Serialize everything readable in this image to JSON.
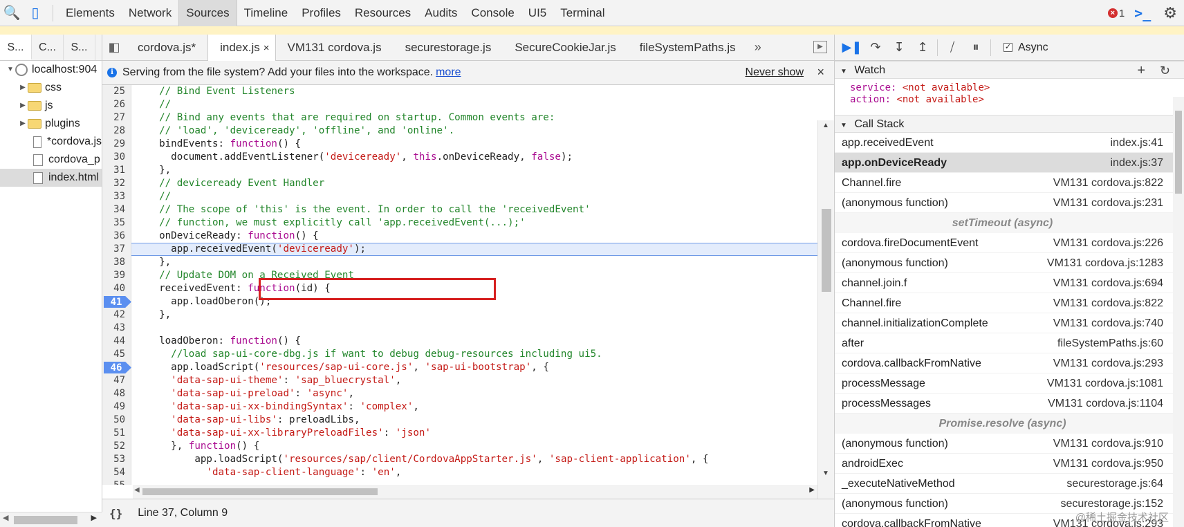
{
  "toolbar": {
    "tabs": [
      "Elements",
      "Network",
      "Sources",
      "Timeline",
      "Profiles",
      "Resources",
      "Audits",
      "Console",
      "UI5",
      "Terminal"
    ],
    "error_count": "1"
  },
  "navigator": {
    "tabs": [
      "S...",
      "C...",
      "S..."
    ],
    "tree": [
      {
        "label": "localhost:904",
        "type": "origin"
      },
      {
        "label": "css",
        "type": "folder"
      },
      {
        "label": "js",
        "type": "folder"
      },
      {
        "label": "plugins",
        "type": "folder"
      },
      {
        "label": "*cordova.js",
        "type": "file"
      },
      {
        "label": "cordova_p",
        "type": "file"
      },
      {
        "label": "index.html",
        "type": "file"
      }
    ]
  },
  "editor": {
    "tabs": [
      "cordova.js*",
      "index.js",
      "VM131 cordova.js",
      "securestorage.js",
      "SecureCookieJar.js",
      "fileSystemPaths.js"
    ],
    "more": "»",
    "info_text": "Serving from the file system? Add your files into the workspace.",
    "info_link": "more",
    "never_show": "Never show",
    "status": "Line 37, Column 9",
    "lines": [
      {
        "n": "25",
        "code": "  // Bind Event Listeners"
      },
      {
        "n": "26",
        "code": "  //"
      },
      {
        "n": "27",
        "code": "  // Bind any events that are required on startup. Common events are:"
      },
      {
        "n": "28",
        "code": "  // 'load', 'deviceready', 'offline', and 'online'."
      },
      {
        "n": "29",
        "code": "  bindEvents: function() {"
      },
      {
        "n": "30",
        "code": "    document.addEventListener('deviceready', this.onDeviceReady, false);"
      },
      {
        "n": "31",
        "code": "  },"
      },
      {
        "n": "32",
        "code": "  // deviceready Event Handler"
      },
      {
        "n": "33",
        "code": "  //"
      },
      {
        "n": "34",
        "code": "  // The scope of 'this' is the event. In order to call the 'receivedEvent'"
      },
      {
        "n": "35",
        "code": "  // function, we must explicitly call 'app.receivedEvent(...);'"
      },
      {
        "n": "36",
        "code": "  onDeviceReady: function() {"
      },
      {
        "n": "37",
        "code": "    app.receivedEvent('deviceready');"
      },
      {
        "n": "38",
        "code": "  },"
      },
      {
        "n": "39",
        "code": "  // Update DOM on a Received Event"
      },
      {
        "n": "40",
        "code": "  receivedEvent: function(id) {"
      },
      {
        "n": "41",
        "code": "    app.loadOberon();"
      },
      {
        "n": "42",
        "code": "  },"
      },
      {
        "n": "43",
        "code": ""
      },
      {
        "n": "44",
        "code": "  loadOberon: function() {"
      },
      {
        "n": "45",
        "code": "    //load sap-ui-core-dbg.js if want to debug debug-resources including ui5."
      },
      {
        "n": "46",
        "code": "    app.loadScript('resources/sap-ui-core.js', 'sap-ui-bootstrap', {"
      },
      {
        "n": "47",
        "code": "    'data-sap-ui-theme': 'sap_bluecrystal',"
      },
      {
        "n": "48",
        "code": "    'data-sap-ui-preload': 'async',"
      },
      {
        "n": "49",
        "code": "    'data-sap-ui-xx-bindingSyntax': 'complex',"
      },
      {
        "n": "50",
        "code": "    'data-sap-ui-libs': preloadLibs,"
      },
      {
        "n": "51",
        "code": "    'data-sap-ui-xx-libraryPreloadFiles': 'json'"
      },
      {
        "n": "52",
        "code": "    }, function() {"
      },
      {
        "n": "53",
        "code": "        app.loadScript('resources/sap/client/CordovaAppStarter.js', 'sap-client-application', {"
      },
      {
        "n": "54",
        "code": "          'data-sap-client-language': 'en',"
      },
      {
        "n": "55",
        "code": ""
      }
    ],
    "breakpoints": [
      "41",
      "46"
    ],
    "exec_line": "37"
  },
  "debugger": {
    "async_label": "Async",
    "watch_title": "Watch",
    "watch": [
      {
        "name": "service",
        "value": "<not available>"
      },
      {
        "name": "action",
        "value": "<not available>"
      }
    ],
    "callstack_title": "Call Stack",
    "frames": [
      {
        "fn": "app.receivedEvent",
        "loc": "index.js:41"
      },
      {
        "fn": "app.onDeviceReady",
        "loc": "index.js:37",
        "current": true
      },
      {
        "fn": "Channel.fire",
        "loc": "VM131 cordova.js:822"
      },
      {
        "fn": "(anonymous function)",
        "loc": "VM131 cordova.js:231"
      },
      {
        "async": "setTimeout (async)"
      },
      {
        "fn": "cordova.fireDocumentEvent",
        "loc": "VM131 cordova.js:226"
      },
      {
        "fn": "(anonymous function)",
        "loc": "VM131 cordova.js:1283"
      },
      {
        "fn": "channel.join.f",
        "loc": "VM131 cordova.js:694"
      },
      {
        "fn": "Channel.fire",
        "loc": "VM131 cordova.js:822"
      },
      {
        "fn": "channel.initializationComplete",
        "loc": "VM131 cordova.js:740"
      },
      {
        "fn": "after",
        "loc": "fileSystemPaths.js:60"
      },
      {
        "fn": "cordova.callbackFromNative",
        "loc": "VM131 cordova.js:293"
      },
      {
        "fn": "processMessage",
        "loc": "VM131 cordova.js:1081"
      },
      {
        "fn": "processMessages",
        "loc": "VM131 cordova.js:1104"
      },
      {
        "async": "Promise.resolve (async)"
      },
      {
        "fn": "(anonymous function)",
        "loc": "VM131 cordova.js:910"
      },
      {
        "fn": "androidExec",
        "loc": "VM131 cordova.js:950"
      },
      {
        "fn": "_executeNativeMethod",
        "loc": "securestorage.js:64"
      },
      {
        "fn": "(anonymous function)",
        "loc": "securestorage.js:152"
      },
      {
        "fn": "cordova.callbackFromNative",
        "loc": "VM131 cordova.js:293"
      }
    ],
    "watermark": "@稀土掘金技术社区"
  }
}
